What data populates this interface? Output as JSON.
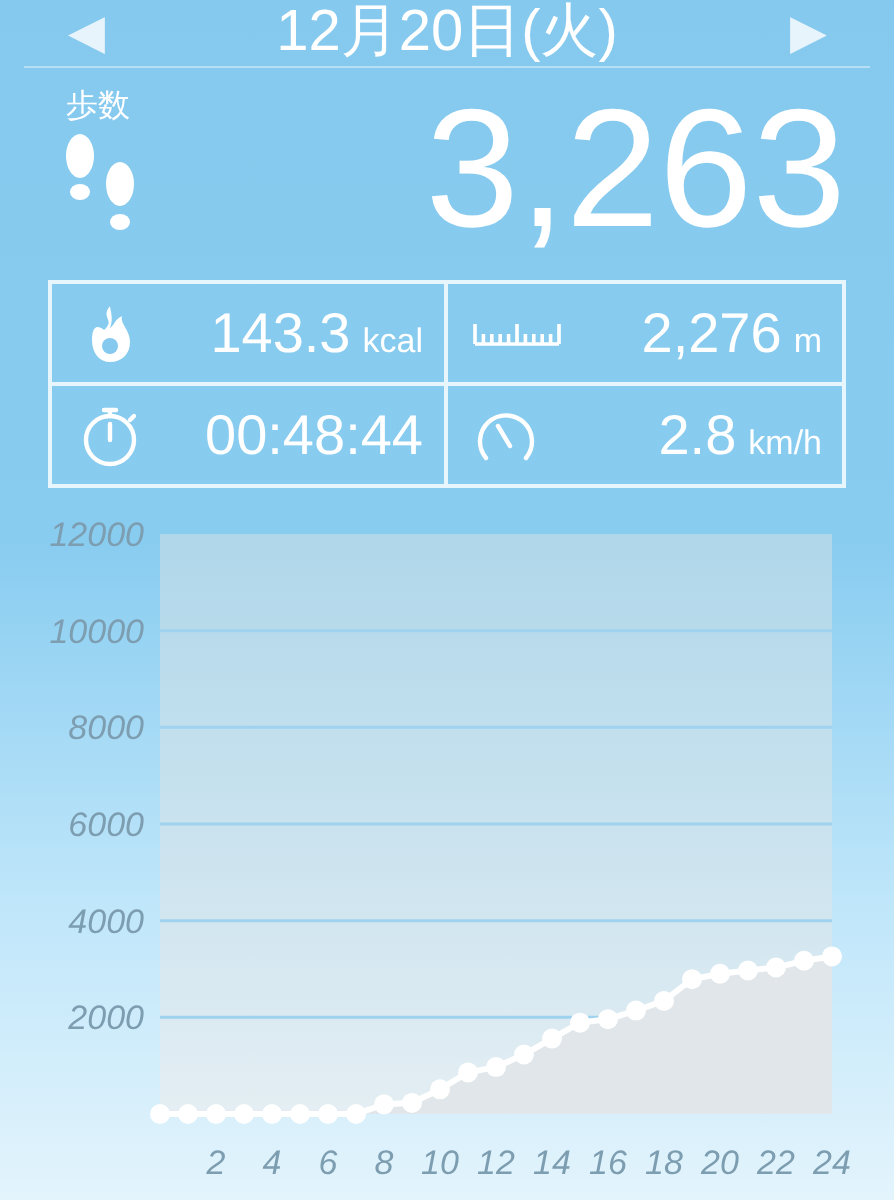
{
  "header": {
    "date": "12月20日(火)",
    "prev": "◀",
    "next": "▶"
  },
  "steps": {
    "label": "歩数",
    "value": "3,263"
  },
  "stats": [
    {
      "kind": "calories",
      "value": "143.3",
      "unit": "kcal"
    },
    {
      "kind": "distance",
      "value": "2,276",
      "unit": "m"
    },
    {
      "kind": "time",
      "value": "00:48:44"
    },
    {
      "kind": "speed",
      "value": "2.8",
      "unit": "km/h"
    }
  ],
  "chart": {
    "chart_data": {
      "type": "area",
      "x": [
        0,
        1,
        2,
        3,
        4,
        5,
        6,
        7,
        8,
        9,
        10,
        11,
        12,
        13,
        14,
        15,
        16,
        17,
        18,
        19,
        20,
        21,
        22,
        23,
        24
      ],
      "series": [
        {
          "color": "#ffffff",
          "values": [
            0,
            0,
            0,
            0,
            0,
            0,
            0,
            0,
            200,
            230,
            510,
            860,
            970,
            1230,
            1560,
            1890,
            1960,
            2140,
            2340,
            2790,
            2900,
            2970,
            3030,
            3170,
            3260
          ]
        }
      ],
      "grid": true,
      "xlim": [
        0,
        24
      ],
      "ylim": [
        0,
        12000
      ],
      "xticks": [
        2,
        4,
        6,
        8,
        10,
        12,
        14,
        16,
        18,
        20,
        22,
        24
      ],
      "yticks": [
        2000,
        4000,
        6000,
        8000,
        10000,
        12000
      ]
    }
  }
}
